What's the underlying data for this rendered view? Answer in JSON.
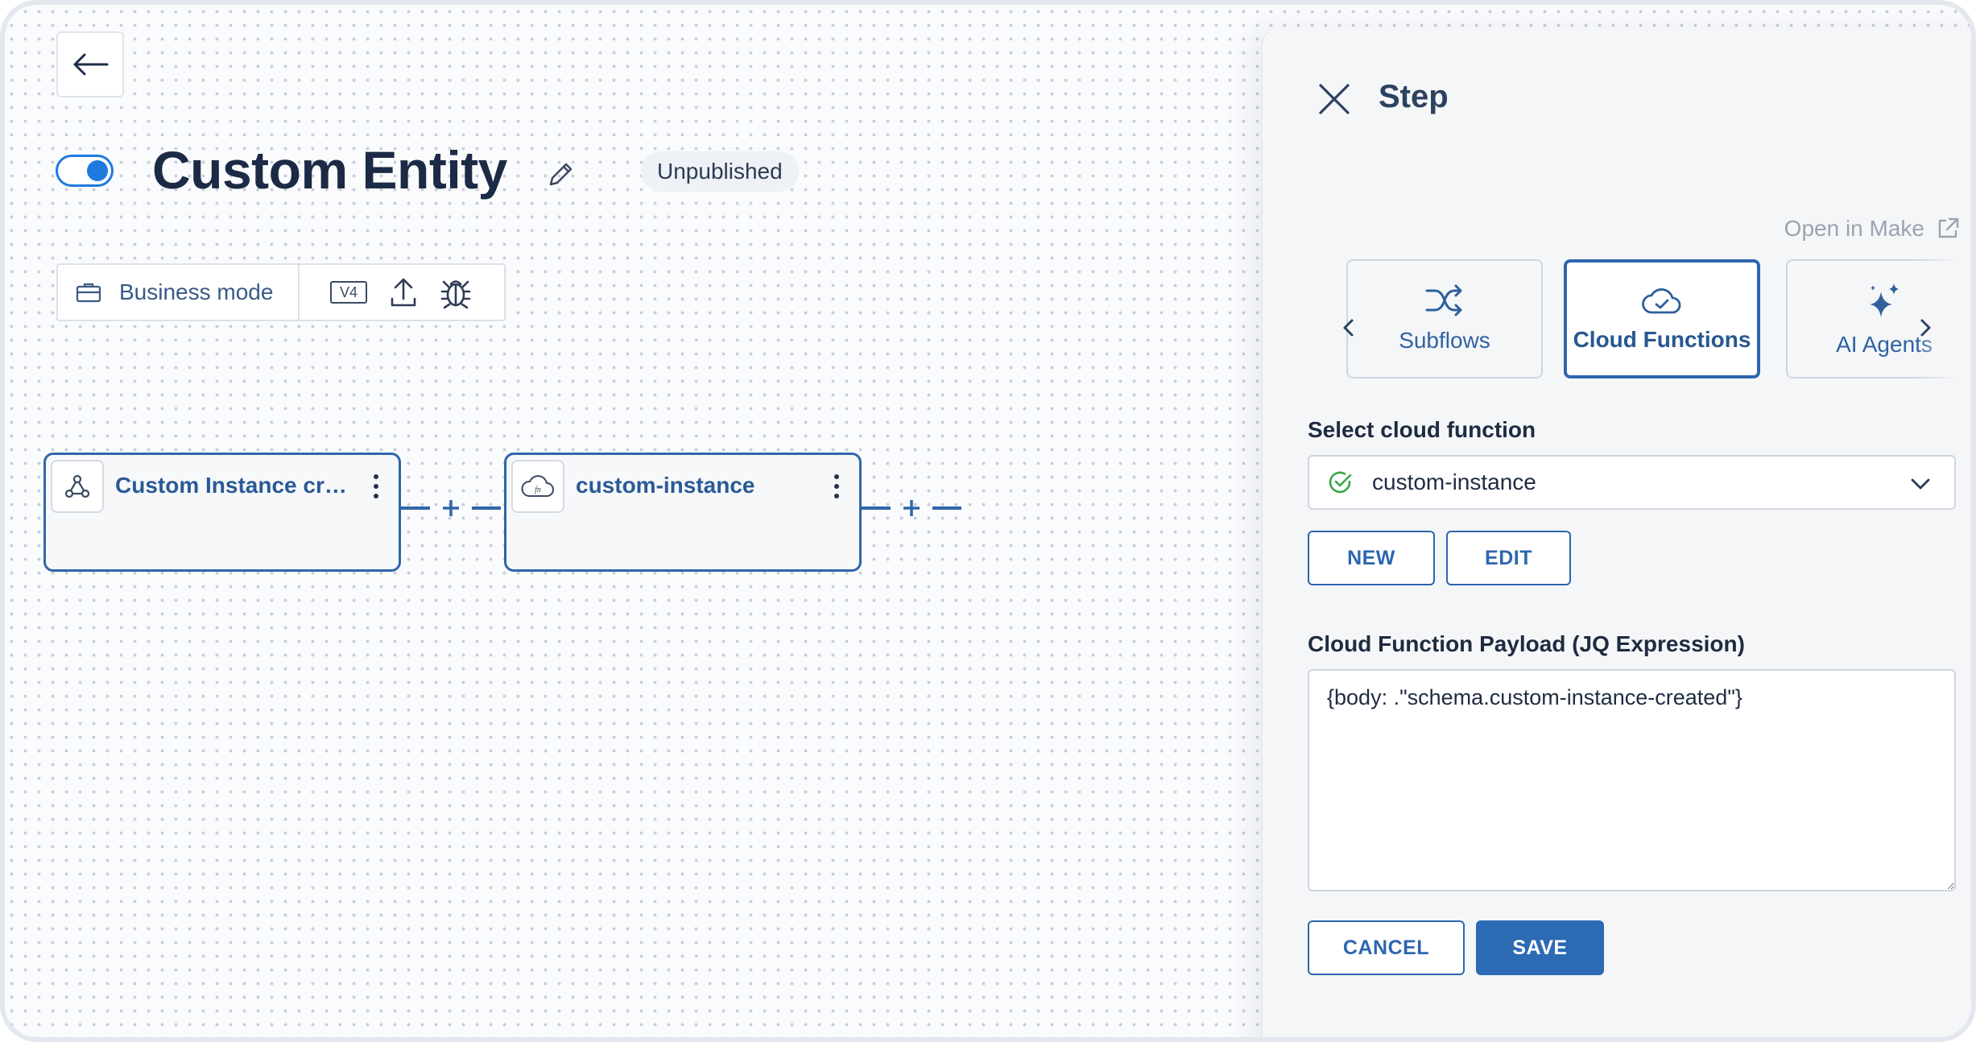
{
  "canvas": {
    "title": "Custom Entity",
    "status": "Unpublished",
    "toolbar": {
      "mode_label": "Business mode",
      "version_badge": "V4"
    },
    "nodes": [
      {
        "label": "Custom Instance created",
        "icon": "webhook-icon"
      },
      {
        "label": "custom-instance",
        "icon": "cloud-function-icon",
        "icon_text": "fn"
      }
    ],
    "connector_symbol": "+"
  },
  "panel": {
    "title": "Step",
    "open_in_make": "Open in Make",
    "tabs": [
      {
        "label": "Subflows",
        "icon": "shuffle-icon"
      },
      {
        "label": "Cloud Functions",
        "icon": "cloud-check-icon",
        "selected": true
      },
      {
        "label": "AI Agents",
        "icon": "sparkles-icon"
      }
    ],
    "select_label": "Select cloud function",
    "select_value": "custom-instance",
    "new_label": "NEW",
    "edit_label": "EDIT",
    "payload_label": "Cloud Function Payload (JQ Expression)",
    "payload_value": "{body: .\"schema.custom-instance-created\"}",
    "cancel_label": "CANCEL",
    "save_label": "SAVE"
  },
  "colors": {
    "accent": "#2d66b0",
    "toggle": "#1f7ae0",
    "success": "#3aa64a"
  }
}
